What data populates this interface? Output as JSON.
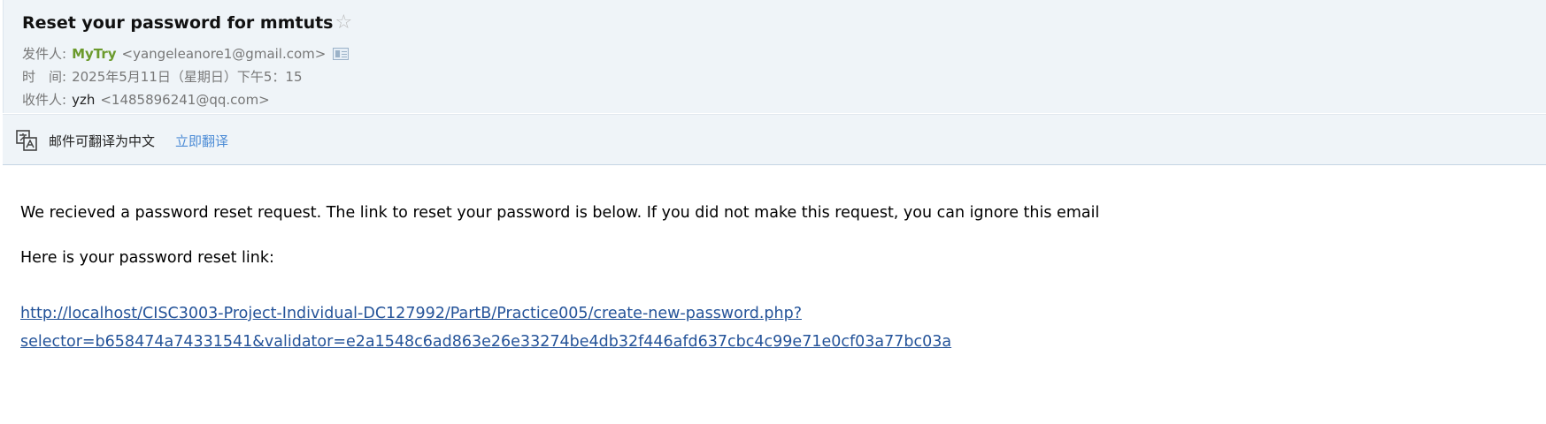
{
  "email": {
    "subject": "Reset your password for mmtuts",
    "from_label": "发件人:",
    "from_name": "MyTry",
    "from_email": "<yangeleanore1@gmail.com>",
    "time_label": "时　间:",
    "time_value": "2025年5月11日（星期日）下午5：15",
    "to_label": "收件人:",
    "to_name": "yzh",
    "to_email": "<1485896241@qq.com>"
  },
  "translate_bar": {
    "text": "邮件可翻译为中文",
    "action": "立即翻译"
  },
  "body": {
    "paragraph1": "We recieved a password reset request. The link to reset your password is below. If you did not make this request, you can ignore this email",
    "paragraph2": "Here is your password reset link:",
    "link_line1": "http://localhost/CISC3003-Project-Individual-DC127992/PartB/Practice005/create-new-password.php?",
    "link_line2": "selector=b658474a74331541&validator=e2a1548c6ad863e26e33274be4db32f446afd637cbc4c99e71e0cf03a77bc03a"
  },
  "icons": {
    "star": "star-outline-icon",
    "contact": "contact-card-icon",
    "translate": "translate-icon"
  }
}
